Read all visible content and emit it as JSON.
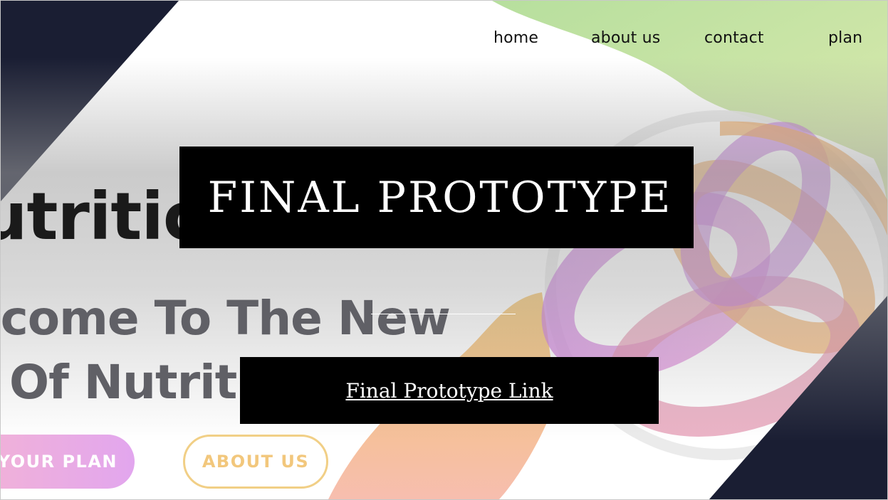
{
  "nav": {
    "home": "home",
    "about": "about us",
    "contact": "contact",
    "plan": "plan"
  },
  "hero": {
    "title_fragment": "utritic",
    "line1": "lcome To The New",
    "line2": "Of Nutriti",
    "plan_button": "YOUR PLAN",
    "about_button": "ABOUT US"
  },
  "slide": {
    "title": "FINAL PROTOTYPE",
    "link_label": "Final Prototype Link"
  },
  "colors": {
    "navy_corner": "#1a1e33",
    "title_box": "#000000",
    "green_blob": "#b8dd96",
    "purple_ring": "#c97be0",
    "orange_ring": "#f0a860"
  }
}
